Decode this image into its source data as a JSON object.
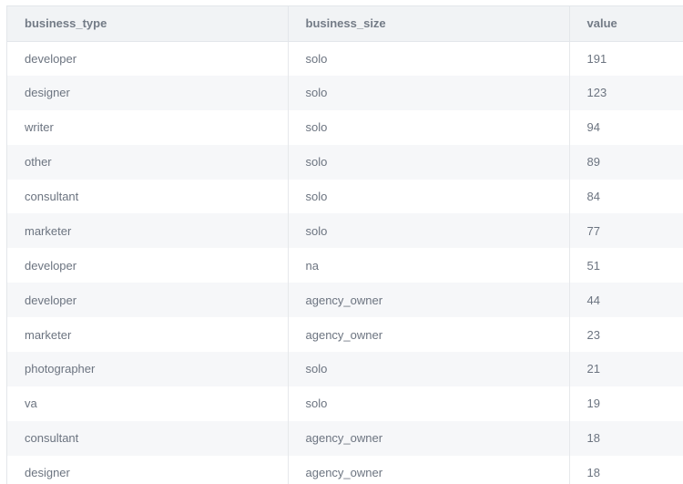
{
  "table": {
    "columns": [
      "business_type",
      "business_size",
      "value"
    ],
    "rows": [
      [
        "developer",
        "solo",
        "191"
      ],
      [
        "designer",
        "solo",
        "123"
      ],
      [
        "writer",
        "solo",
        "94"
      ],
      [
        "other",
        "solo",
        "89"
      ],
      [
        "consultant",
        "solo",
        "84"
      ],
      [
        "marketer",
        "solo",
        "77"
      ],
      [
        "developer",
        "na",
        "51"
      ],
      [
        "developer",
        "agency_owner",
        "44"
      ],
      [
        "marketer",
        "agency_owner",
        "23"
      ],
      [
        "photographer",
        "solo",
        "21"
      ],
      [
        "va",
        "solo",
        "19"
      ],
      [
        "consultant",
        "agency_owner",
        "18"
      ],
      [
        "designer",
        "agency_owner",
        "18"
      ]
    ]
  }
}
